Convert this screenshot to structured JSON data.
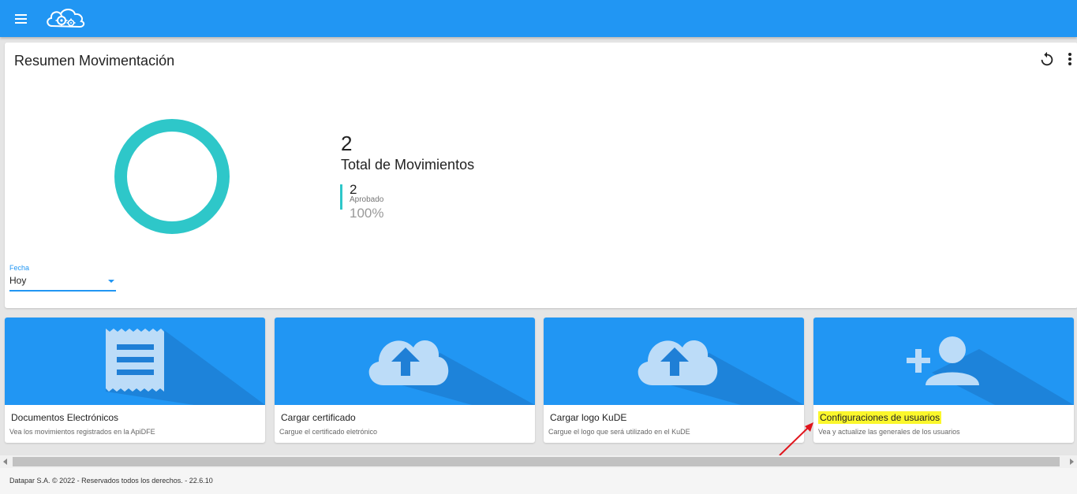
{
  "colors": {
    "primary": "#2196f3",
    "accent_teal": "#2ec7c9",
    "highlight": "#fbf72c",
    "annotation_arrow": "#e0141c"
  },
  "header": {
    "menu_icon": "hamburger-menu-icon",
    "logo_icon": "cloud-gears-logo"
  },
  "summary": {
    "title": "Resumen Movimentación",
    "refresh_icon": "refresh-icon",
    "more_icon": "more-vert-icon",
    "total_value": "2",
    "total_label": "Total de Movimientos",
    "legend": [
      {
        "count": "2",
        "label": "Aprobado",
        "percent": "100%"
      }
    ],
    "date_filter": {
      "label": "Fecha",
      "value": "Hoy"
    }
  },
  "chart_data": {
    "type": "pie",
    "categories": [
      "Aprobado"
    ],
    "values": [
      2
    ],
    "colors": [
      "#2ec7c9"
    ],
    "donut": true
  },
  "tiles": [
    {
      "title": "Documentos Electrónicos",
      "description": "Vea los movimientos registrados en la ApiDFE",
      "icon": "receipt-icon"
    },
    {
      "title": "Cargar certificado",
      "description": "Cargue el certificado eletrónico",
      "icon": "cloud-upload-icon"
    },
    {
      "title": "Cargar logo KuDE",
      "description": "Cargue el logo que será utilizado en el KuDE",
      "icon": "cloud-upload-icon"
    },
    {
      "title": "Configuraciones de usuarios",
      "description": "Vea y actualize las generales de los usuarios",
      "icon": "person-add-icon"
    }
  ],
  "footer": {
    "text": "Datapar S.A. © 2022 - Reservados todos los derechos. - 22.6.10"
  }
}
